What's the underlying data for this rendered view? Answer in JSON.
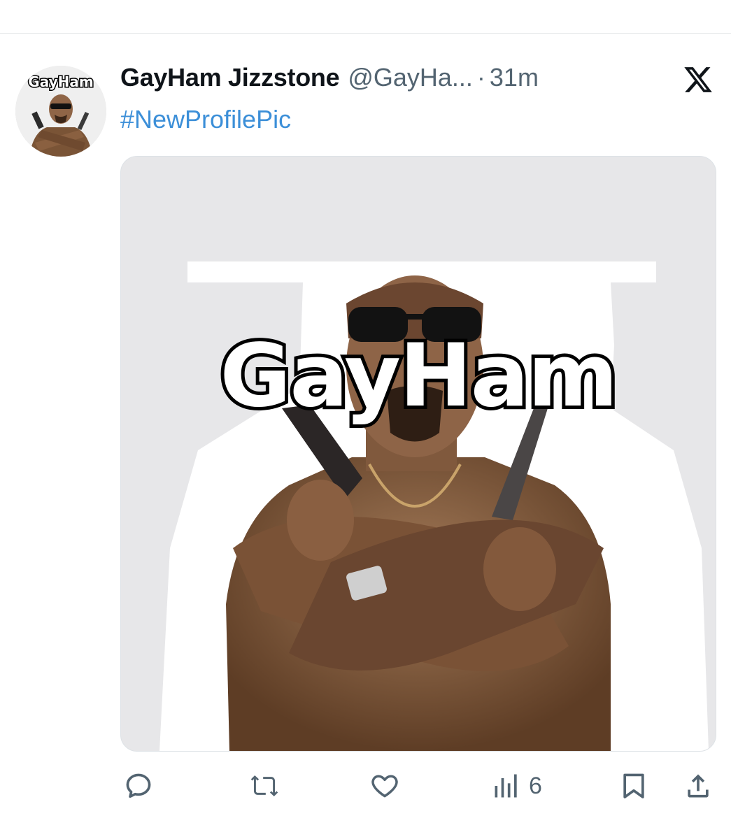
{
  "tweet": {
    "display_name": "GayHam Jizzstone",
    "handle": "@GayHa...",
    "separator": "·",
    "time": "31m",
    "text": "#NewProfilePic",
    "avatar_label": "GayHam",
    "media_caption": "GayHam"
  },
  "actions": {
    "views_count": "6"
  },
  "icons": {
    "reply": "reply-icon",
    "retweet": "retweet-icon",
    "like": "heart-icon",
    "views": "views-icon",
    "bookmark": "bookmark-icon",
    "share": "share-icon",
    "brand": "x-logo-icon"
  },
  "colors": {
    "hashtag": "#3c8fd8",
    "muted": "#536471",
    "text": "#0f1419"
  }
}
